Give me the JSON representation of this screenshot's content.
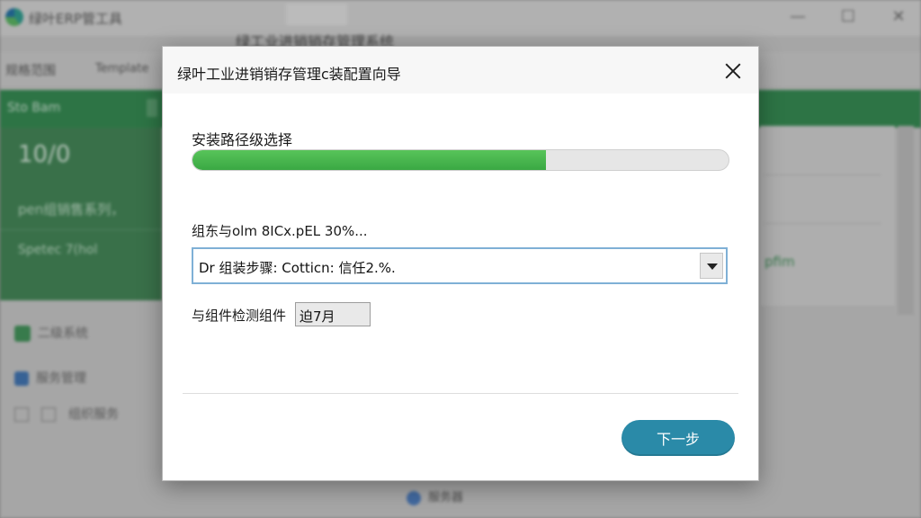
{
  "background_app": {
    "app_title": "绿叶ERP管工具",
    "heading": "绿工业进销销存管理系统",
    "toolbar_a": "规格范围",
    "toolbar_b": "Template",
    "sidebar_header": "Sto Bam",
    "stat_big": "10/0",
    "stat_a": "pen组销售系列，",
    "stat_b": "Spetec 7(hol",
    "side_item1": "二级系统",
    "side_item2": "服务管理",
    "side_item3": "组织服务",
    "right_green": "pfim",
    "bottom_item": "服务器"
  },
  "dialog": {
    "title": "绿叶工业进销销存管理c装配置向导",
    "section_label": "安装路径级选择",
    "progress_fraction": 0.66,
    "component_label": "组东与olm 8ICx.pEL 30%...",
    "select_value": "Dr 组装步骤: Cotticn: 信任2.%.",
    "check_label": "与组件检测组件",
    "check_value": "迫7月",
    "next_label": "下一步"
  },
  "colors": {
    "progress_green": "#3aa843",
    "next_button": "#2a8aa8",
    "sidebar_green": "#2f8a4e"
  }
}
